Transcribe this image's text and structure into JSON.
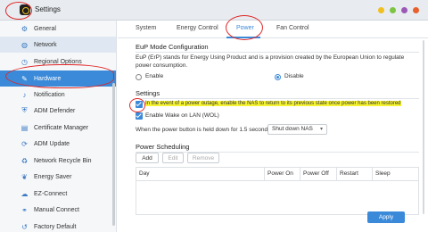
{
  "window": {
    "title": "Settings",
    "controls": [
      {
        "name": "minimize",
        "color": "#f0c020"
      },
      {
        "name": "maximize",
        "color": "#7cc442"
      },
      {
        "name": "fullscreen",
        "color": "#9b59b6"
      },
      {
        "name": "close",
        "color": "#e8602c"
      }
    ]
  },
  "sidebar": {
    "items": [
      {
        "label": "General",
        "icon": "gear-icon"
      },
      {
        "label": "Network",
        "icon": "globe-icon"
      },
      {
        "label": "Regional Options",
        "icon": "clock-icon"
      },
      {
        "label": "Hardware",
        "icon": "hardware-icon",
        "active": true
      },
      {
        "label": "Notification",
        "icon": "bell-icon"
      },
      {
        "label": "ADM Defender",
        "icon": "shield-icon"
      },
      {
        "label": "Certificate Manager",
        "icon": "certificate-icon"
      },
      {
        "label": "ADM Update",
        "icon": "update-icon"
      },
      {
        "label": "Network Recycle Bin",
        "icon": "recycle-bin-icon"
      },
      {
        "label": "Energy Saver",
        "icon": "leaf-icon"
      },
      {
        "label": "EZ-Connect",
        "icon": "cloud-icon"
      },
      {
        "label": "Manual Connect",
        "icon": "link-icon"
      },
      {
        "label": "Factory Default",
        "icon": "reset-icon"
      }
    ]
  },
  "tabs": [
    {
      "label": "System"
    },
    {
      "label": "Energy Control"
    },
    {
      "label": "Power",
      "active": true
    },
    {
      "label": "Fan Control"
    }
  ],
  "eup": {
    "title": "EuP Mode Configuration",
    "description": "EuP (ErP) stands for Energy Using Product and is a provision created by the European Union to regulate power consumption.",
    "enable_label": "Enable",
    "disable_label": "Disable",
    "selected": "Disable"
  },
  "settings": {
    "title": "Settings",
    "restore_label": "In the event of a power outage, enable the NAS to return to its previous state once power has been restored",
    "restore_checked": true,
    "wol_label": "Enable Wake on LAN (WOL)",
    "wol_checked": true,
    "power_button_label": "When the power button is held down for 1.5 seconds:",
    "power_button_value": "Shut down NAS"
  },
  "scheduling": {
    "title": "Power Scheduling",
    "add_label": "Add",
    "edit_label": "Edit",
    "remove_label": "Remove",
    "columns": [
      "Day",
      "Power On",
      "Power Off",
      "Restart",
      "Sleep"
    ],
    "rows": []
  },
  "apply_label": "Apply",
  "colors": {
    "accent": "#3b8ad9",
    "highlight": "#f6f432",
    "annotation": "#e02424"
  }
}
